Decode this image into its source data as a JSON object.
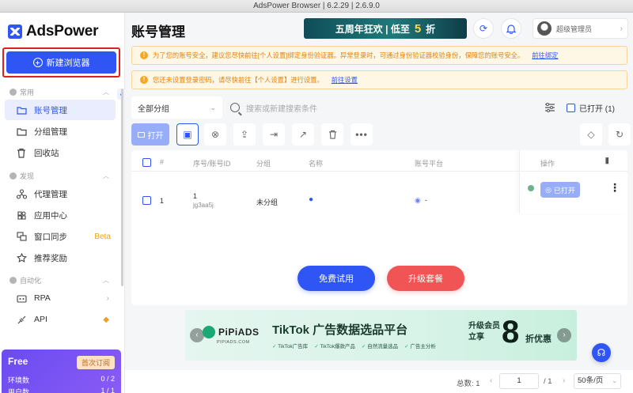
{
  "window": {
    "title": "AdsPower Browser | 6.2.29 | 2.6.9.0"
  },
  "sidebar": {
    "logo_text": "AdsPower",
    "new_browser_label": "新建浏览器",
    "sections": [
      {
        "label": "常用"
      },
      {
        "label": "发现"
      },
      {
        "label": "自动化"
      }
    ],
    "items": [
      {
        "label": "账号管理",
        "icon": "folder-icon",
        "active": true
      },
      {
        "label": "分组管理",
        "icon": "folder-group-icon"
      },
      {
        "label": "回收站",
        "icon": "trash-icon"
      },
      {
        "label": "代理管理",
        "icon": "proxy-icon"
      },
      {
        "label": "应用中心",
        "icon": "app-center-icon"
      },
      {
        "label": "窗口同步",
        "icon": "window-sync-icon",
        "badge": "Beta"
      },
      {
        "label": "推荐奖励",
        "icon": "gift-icon"
      },
      {
        "label": "RPA",
        "icon": "rpa-icon"
      },
      {
        "label": "API",
        "icon": "api-icon"
      }
    ],
    "plan": {
      "name": "Free",
      "cta": "首次订阅",
      "env_label": "环境数",
      "env_value": "0 / 2",
      "users_label": "用户数",
      "users_value": "1 / 1",
      "color": "#7c55f3"
    }
  },
  "header": {
    "title": "账号管理",
    "promo": {
      "text": "五周年狂欢 | 低至",
      "number": "5",
      "suffix": "折"
    },
    "user_name": "超级管理员"
  },
  "alerts": [
    {
      "text": "为了您的账号安全，建议您尽快前往[个人设置]绑定身份验证器。异常登录时，可通过身份验证器校验身份，保障您的账号安全。",
      "link": "前往绑定"
    },
    {
      "text": "您还未设置登录密码，请尽快前往【个人设置】进行设置。",
      "link": "前往设置"
    }
  ],
  "filters": {
    "group_select": "全部分组",
    "search_placeholder": "搜索或新建搜索条件",
    "opened_label": "已打开 (1)"
  },
  "toolbar": {
    "open_label": "打开"
  },
  "table": {
    "columns": [
      "#",
      "序号/账号ID",
      "分组",
      "名称",
      "账号平台",
      "操作"
    ],
    "rows": [
      {
        "index": "1",
        "serial": "1",
        "account_id": "jg3aa5j",
        "group": "未分组",
        "name_icon": "apple-icon",
        "platform": "-",
        "status": "已打开"
      }
    ]
  },
  "actions": {
    "free_trial": "免费试用",
    "upgrade": "升级套餐"
  },
  "ad": {
    "brand": "PiPiADS",
    "brand_sub": "PIPIADS.COM",
    "title": "TikTok 广告数据选品平台",
    "tags": [
      "TikTok广告库",
      "TikTok爆款产品",
      "自然流量选品",
      "广告主分析"
    ],
    "upgrade_line1": "升级会员",
    "upgrade_line2": "立享",
    "discount_number": "8",
    "discount_text": "折优惠"
  },
  "pager": {
    "total": "总数: 1",
    "page": "1",
    "pages": "/ 1",
    "per_page": "50条/页"
  },
  "colors": {
    "primary": "#2f56f4",
    "danger": "#f05454",
    "warning": "#e0820e"
  }
}
